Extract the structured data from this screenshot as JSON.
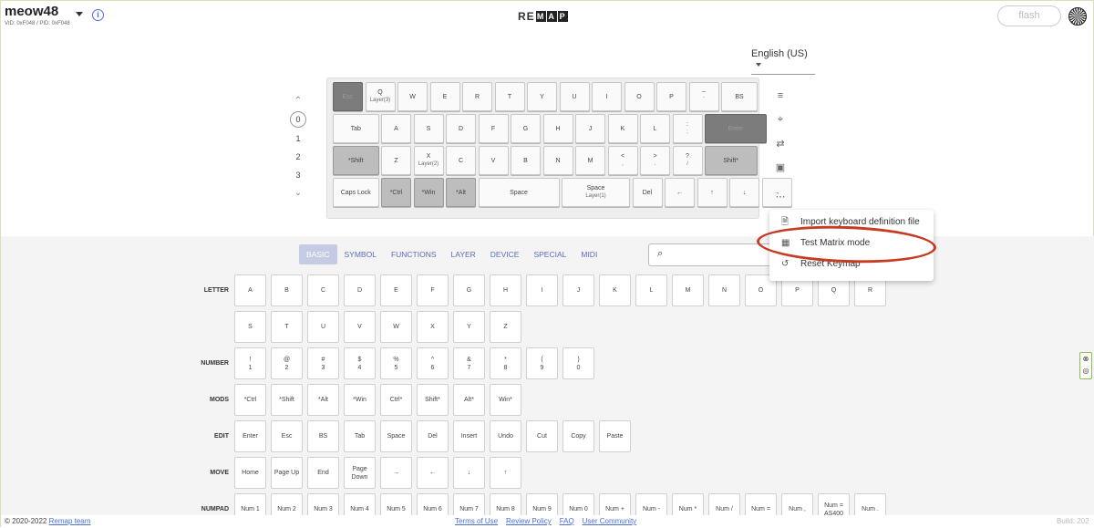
{
  "header": {
    "title": "meow48",
    "subtitle": "VID: 0xF048 / PID: 0xF048",
    "logo_left": "RE",
    "logo_boxes": [
      "M",
      "A",
      "P"
    ],
    "flash_label": "flash"
  },
  "language": "English (US)",
  "layers": {
    "items": [
      "0",
      "1",
      "2",
      "3"
    ],
    "selected": "0"
  },
  "keyboard": {
    "rows": [
      [
        {
          "l": "Esc",
          "s": "dark"
        },
        {
          "l": "Q",
          "sub": "Layer(3)"
        },
        {
          "l": "W"
        },
        {
          "l": "E"
        },
        {
          "l": "R"
        },
        {
          "l": "T"
        },
        {
          "l": "Y"
        },
        {
          "l": "U"
        },
        {
          "l": "I"
        },
        {
          "l": "O"
        },
        {
          "l": "P"
        },
        {
          "l": "~",
          "sub": "`"
        },
        {
          "l": "BS"
        }
      ],
      [
        {
          "l": "Tab"
        },
        {
          "l": "A"
        },
        {
          "l": "S"
        },
        {
          "l": "D"
        },
        {
          "l": "F"
        },
        {
          "l": "G"
        },
        {
          "l": "H"
        },
        {
          "l": "J"
        },
        {
          "l": "K"
        },
        {
          "l": "L"
        },
        {
          "l": ":",
          "sub": ";"
        },
        {
          "l": "Enter",
          "s": "dark"
        }
      ],
      [
        {
          "l": "*Shift",
          "s": "mid"
        },
        {
          "l": "Z"
        },
        {
          "l": "X",
          "sub": "Layer(2)"
        },
        {
          "l": "C"
        },
        {
          "l": "V"
        },
        {
          "l": "B"
        },
        {
          "l": "N"
        },
        {
          "l": "M"
        },
        {
          "l": "<",
          "sub": ","
        },
        {
          "l": ">",
          "sub": "."
        },
        {
          "l": "?",
          "sub": "/"
        },
        {
          "l": "Shift*",
          "s": "mid"
        }
      ],
      [
        {
          "l": "Caps Lock"
        },
        {
          "l": "*Ctrl",
          "s": "mid"
        },
        {
          "l": "*Win",
          "s": "mid"
        },
        {
          "l": "*Alt",
          "s": "mid"
        },
        {
          "l": "Space"
        },
        {
          "l": "Space",
          "sub": "Layer(1)"
        },
        {
          "l": "Del"
        },
        {
          "l": "←"
        },
        {
          "l": "↑"
        },
        {
          "l": "↓"
        },
        {
          "l": "→"
        }
      ]
    ]
  },
  "menu": {
    "items": [
      {
        "label": "Import keyboard definition file",
        "icon": "file-icon"
      },
      {
        "label": "Test Matrix mode",
        "icon": "grid-icon"
      },
      {
        "label": "Reset Keymap",
        "icon": "reset-icon"
      }
    ]
  },
  "tabs": [
    "BASIC",
    "SYMBOL",
    "FUNCTIONS",
    "LAYER",
    "DEVICE",
    "SPECIAL",
    "MIDI"
  ],
  "active_tab": "BASIC",
  "palette": {
    "letter_label": "LETTER",
    "letters_row1": [
      "A",
      "B",
      "C",
      "D",
      "E",
      "F",
      "G",
      "H",
      "I",
      "J",
      "K",
      "L",
      "M",
      "N",
      "O",
      "P",
      "Q",
      "R"
    ],
    "letters_row2": [
      "S",
      "T",
      "U",
      "V",
      "W",
      "X",
      "Y",
      "Z"
    ],
    "number_label": "NUMBER",
    "numbers": [
      {
        "t": "!",
        "b": "1"
      },
      {
        "t": "@",
        "b": "2"
      },
      {
        "t": "#",
        "b": "3"
      },
      {
        "t": "$",
        "b": "4"
      },
      {
        "t": "%",
        "b": "5"
      },
      {
        "t": "^",
        "b": "6"
      },
      {
        "t": "&",
        "b": "7"
      },
      {
        "t": "*",
        "b": "8"
      },
      {
        "t": "(",
        "b": "9"
      },
      {
        "t": ")",
        "b": "0"
      }
    ],
    "mods_label": "MODS",
    "mods": [
      "*Ctrl",
      "*Shift",
      "*Alt",
      "*Win",
      "Ctrl*",
      "Shift*",
      "Alt*",
      "Win*"
    ],
    "edit_label": "EDIT",
    "edit": [
      "Enter",
      "Esc",
      "BS",
      "Tab",
      "Space",
      "Del",
      "Insert",
      "Undo",
      "Cut",
      "Copy",
      "Paste"
    ],
    "move_label": "MOVE",
    "move": [
      "Home",
      "Page Up",
      "End",
      "Page Down",
      "→",
      "←",
      "↓",
      "↑"
    ],
    "numpad_label": "NUMPAD",
    "numpad": [
      "Num 1",
      "Num 2",
      "Num 3",
      "Num 4",
      "Num 5",
      "Num 6",
      "Num 7",
      "Num 8",
      "Num 9",
      "Num 0",
      "Num +",
      "Num -",
      "Num *",
      "Num /",
      "Num =",
      "Num ,",
      "Num = AS400",
      "Num ."
    ]
  },
  "footer": {
    "copyright": "© 2020-2022",
    "team_link": "Remap team",
    "links": [
      "Terms of Use",
      "Review Policy",
      "FAQ",
      "User Community"
    ],
    "build": "Build: 202"
  }
}
